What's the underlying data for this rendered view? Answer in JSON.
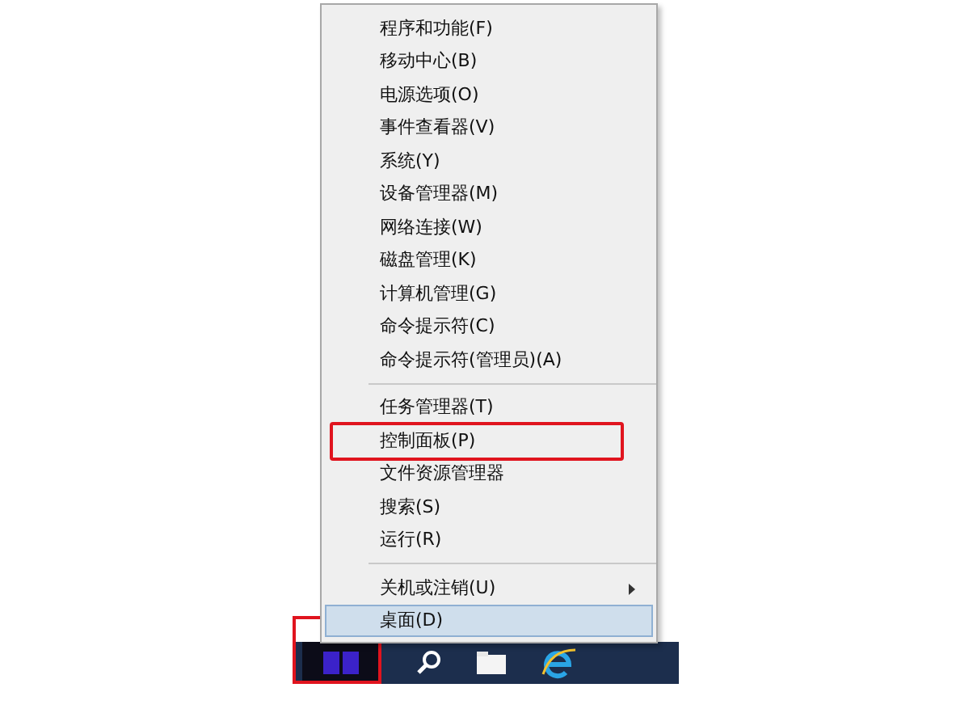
{
  "menu": {
    "groups": [
      {
        "items": [
          {
            "label": "程序和功能(F)",
            "selected": false,
            "annotated": false,
            "submenu": false
          },
          {
            "label": "移动中心(B)",
            "selected": false,
            "annotated": false,
            "submenu": false
          },
          {
            "label": "电源选项(O)",
            "selected": false,
            "annotated": false,
            "submenu": false
          },
          {
            "label": "事件查看器(V)",
            "selected": false,
            "annotated": false,
            "submenu": false
          },
          {
            "label": "系统(Y)",
            "selected": false,
            "annotated": false,
            "submenu": false
          },
          {
            "label": "设备管理器(M)",
            "selected": false,
            "annotated": false,
            "submenu": false
          },
          {
            "label": "网络连接(W)",
            "selected": false,
            "annotated": false,
            "submenu": false
          },
          {
            "label": "磁盘管理(K)",
            "selected": false,
            "annotated": false,
            "submenu": false
          },
          {
            "label": "计算机管理(G)",
            "selected": false,
            "annotated": false,
            "submenu": false
          },
          {
            "label": "命令提示符(C)",
            "selected": false,
            "annotated": false,
            "submenu": false
          },
          {
            "label": "命令提示符(管理员)(A)",
            "selected": false,
            "annotated": false,
            "submenu": false
          }
        ]
      },
      {
        "items": [
          {
            "label": "任务管理器(T)",
            "selected": false,
            "annotated": false,
            "submenu": false
          },
          {
            "label": "控制面板(P)",
            "selected": false,
            "annotated": true,
            "submenu": false
          },
          {
            "label": "文件资源管理器",
            "selected": false,
            "annotated": false,
            "submenu": false
          },
          {
            "label": "搜索(S)",
            "selected": false,
            "annotated": false,
            "submenu": false
          },
          {
            "label": "运行(R)",
            "selected": false,
            "annotated": false,
            "submenu": false
          }
        ]
      },
      {
        "items": [
          {
            "label": "关机或注销(U)",
            "selected": false,
            "annotated": false,
            "submenu": true
          },
          {
            "label": "桌面(D)",
            "selected": true,
            "annotated": false,
            "submenu": false
          }
        ]
      }
    ]
  },
  "taskbar": {
    "start_annotated": true
  }
}
